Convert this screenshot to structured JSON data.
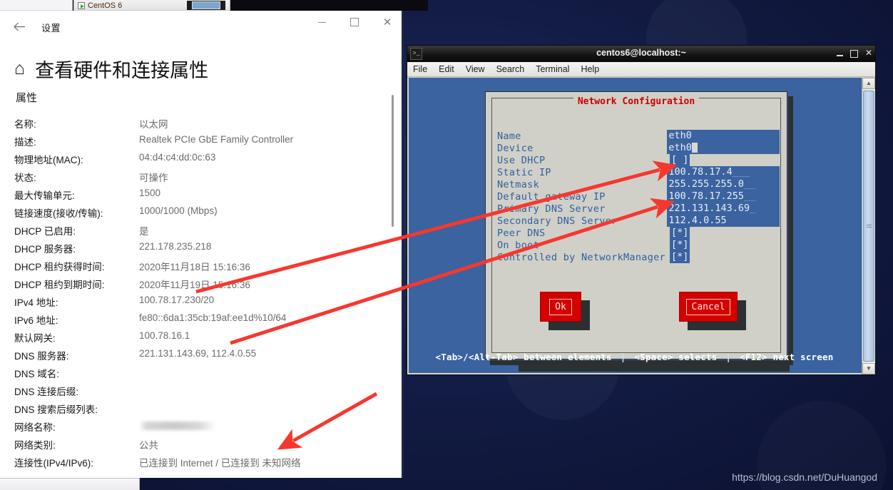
{
  "taskbar": {
    "app_label": "CentOS 6"
  },
  "settings": {
    "window_title": "设置",
    "back_icon": "back-arrow-icon",
    "minimize_label": "",
    "maximize_label": "",
    "close_label": "✕",
    "home_icon": "⌂",
    "page_title": "查看硬件和连接属性",
    "section_subtitle": "属性",
    "properties": [
      {
        "label": "名称:",
        "value": "以太网"
      },
      {
        "label": "描述:",
        "value": "Realtek PCIe GbE Family Controller"
      },
      {
        "label": "物理地址(MAC):",
        "value": "04:d4:c4:dd:0c:63"
      },
      {
        "label": "状态:",
        "value": "可操作"
      },
      {
        "label": "最大传输单元:",
        "value": "1500"
      },
      {
        "label": "链接速度(接收/传输):",
        "value": "1000/1000 (Mbps)"
      },
      {
        "label": "DHCP 已启用:",
        "value": "是"
      },
      {
        "label": "DHCP 服务器:",
        "value": "221.178.235.218"
      },
      {
        "label": "DHCP 租约获得时间:",
        "value": "2020年11月18日 15:16:36"
      },
      {
        "label": "DHCP 租约到期时间:",
        "value": "2020年11月19日 15:16:36"
      },
      {
        "label": "IPv4 地址:",
        "value": "100.78.17.230/20"
      },
      {
        "label": "IPv6 地址:",
        "value": "fe80::6da1:35cb:19af:ee1d%10/64"
      },
      {
        "label": "默认网关:",
        "value": "100.78.16.1"
      },
      {
        "label": "DNS 服务器:",
        "value": "221.131.143.69, 112.4.0.55"
      },
      {
        "label": "DNS 域名:",
        "value": ""
      },
      {
        "label": "DNS 连接后缀:",
        "value": ""
      },
      {
        "label": "DNS 搜索后缀列表:",
        "value": ""
      },
      {
        "label": "网络名称:",
        "value": "",
        "blurred": true
      },
      {
        "label": "网络类别:",
        "value": "公共"
      },
      {
        "label": "连接性(IPv4/IPv6):",
        "value": "已连接到 Internet / 已连接到 未知网络"
      }
    ]
  },
  "terminal": {
    "title": "centos6@localhost:~",
    "icon": "terminal-icon",
    "minimize_label": "",
    "maximize_label": "",
    "close_label": "✕",
    "menu": [
      "File",
      "Edit",
      "View",
      "Search",
      "Terminal",
      "Help"
    ],
    "scrollbar": {
      "up_arrow": "▲",
      "down_arrow": "▼"
    },
    "status": {
      "part1": "<Tab>/<Alt-Tab> between elements",
      "sep": "|",
      "part2": "<Space> selects",
      "part3": "<F12> next screen"
    }
  },
  "dialog": {
    "title": "Network Configuration",
    "title_color": "#cc0000",
    "fields": [
      {
        "label": "Name",
        "value": "eth0",
        "type": "text",
        "fill": ""
      },
      {
        "label": "Device",
        "value": "eth0",
        "type": "text-cursor",
        "fill": ""
      },
      {
        "label": "Use DHCP",
        "value": "[ ]",
        "type": "checkbox",
        "fill": ""
      },
      {
        "label": "Static IP",
        "value": "100.78.17.4",
        "type": "text",
        "fill": "___"
      },
      {
        "label": "Netmask",
        "value": "255.255.255.0",
        "type": "text",
        "fill": "__"
      },
      {
        "label": "Default gateway IP",
        "value": "100.78.17.255",
        "type": "text",
        "fill": "__"
      },
      {
        "label": "Primary DNS Server",
        "value": "221.131.143.69",
        "type": "text",
        "fill": "_"
      },
      {
        "label": "Secondary DNS Server",
        "value": "112.4.0.55",
        "type": "text",
        "fill": ""
      },
      {
        "label": "Peer DNS",
        "value": "[*]",
        "type": "checkbox",
        "fill": ""
      },
      {
        "label": "On boot",
        "value": "[*]",
        "type": "checkbox",
        "fill": ""
      },
      {
        "label": "Controlled by NetworkManager",
        "value": "[*]",
        "type": "checkbox",
        "fill": ""
      }
    ],
    "ok_label": "Ok",
    "cancel_label": "Cancel"
  },
  "annotations": {
    "arrow_color": "#f7372e",
    "arrows": [
      {
        "name": "arrow-ipv4-to-static-ip",
        "from": "IPv4 地址",
        "to": "Static IP"
      },
      {
        "name": "arrow-dns-to-primary-dns",
        "from": "DNS 服务器",
        "to": "Primary DNS Server"
      },
      {
        "name": "arrow-to-connectivity",
        "from": "",
        "to": "连接性(IPv4/IPv6)"
      }
    ]
  },
  "watermark": {
    "text": "https://blog.csdn.net/DuHuangod"
  }
}
